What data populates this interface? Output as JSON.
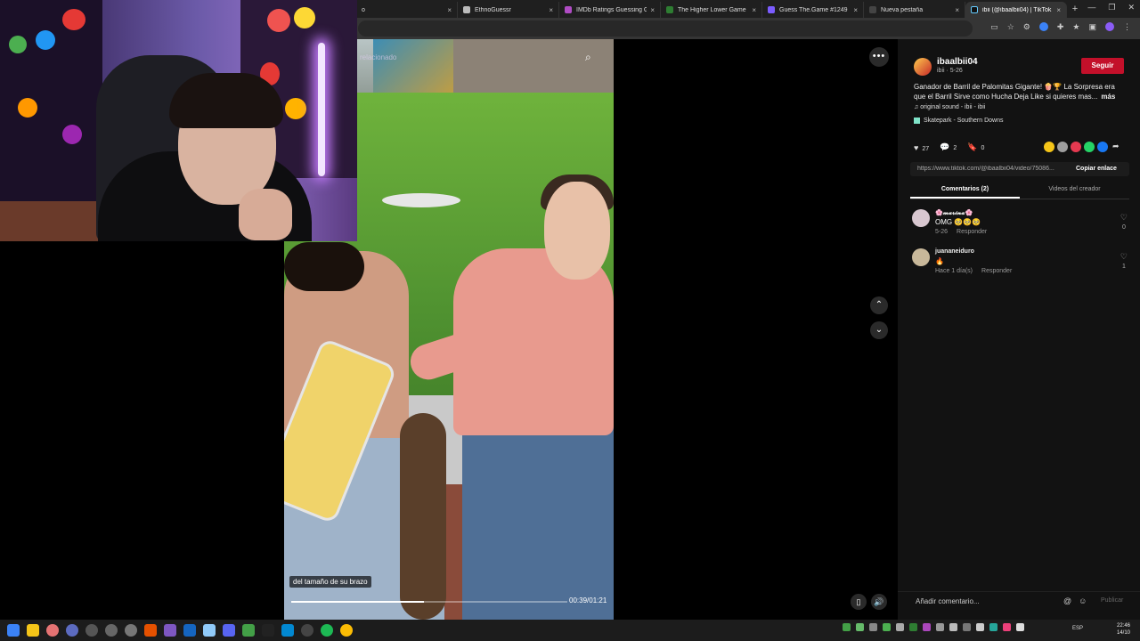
{
  "browser": {
    "tabs": [
      {
        "title": "o",
        "favicon_color": "#888888",
        "active": false
      },
      {
        "title": "EthnoGuessr",
        "favicon_color": "#bbbbbb",
        "active": false
      },
      {
        "title": "IMDb Ratings Guessing Game",
        "favicon_color": "#b04cc4",
        "active": false
      },
      {
        "title": "The Higher Lower Game",
        "favicon_color": "#2e7d32",
        "active": false
      },
      {
        "title": "Guess The.Game #1249",
        "favicon_color": "#7b5cff",
        "active": false
      },
      {
        "title": "Nueva pestaña",
        "favicon_color": "#444444",
        "active": false
      },
      {
        "title": "ibii (@ibaalbii04) | TikTok",
        "favicon_color": "#111111",
        "active": true
      }
    ],
    "new_tab": "+",
    "close": "×"
  },
  "video": {
    "overlay_label": "relacionado",
    "caption": "del tamaño de su brazo",
    "timecode": "00:39/01:21",
    "progress": 0.48
  },
  "panel": {
    "username": "ibaalbii04",
    "subline": "ibii · 5-26",
    "follow_label": "Seguir",
    "description": "Ganador de Barril de Palomitas Gigante! 🍿🏆 La Sorpresa era que el Barril Sirve como Hucha Deja Like si quieres mas...",
    "more_label": "más",
    "sound": "♫ original sound - ibii - ibii",
    "place": "Skatepark - Southern Downs",
    "stats": {
      "likes": "27",
      "comments": "2",
      "saves": "0"
    },
    "link_url": "https://www.tiktok.com/@ibaalbii04/video/75086...",
    "copy_label": "Copiar enlace",
    "tab_comments": "Comentarios (2)",
    "tab_creator": "Videos del creador",
    "comments": [
      {
        "name": "🌸𝓶𝓪𝓻𝓲𝓷𝓪🌸",
        "text": "OMG 🥺🥺🥺",
        "date": "5-26",
        "reply": "Responder",
        "likes": "0"
      },
      {
        "name": "juananeiduro",
        "text": "🔥",
        "date": "Hace 1 día(s)",
        "reply": "Responder",
        "likes": "1"
      }
    ],
    "add_comment_placeholder": "Añadir comentario...",
    "publish_label": "Publicar"
  },
  "taskbar": {
    "lang": "ESP",
    "time": "22:46",
    "date": "14/10"
  }
}
